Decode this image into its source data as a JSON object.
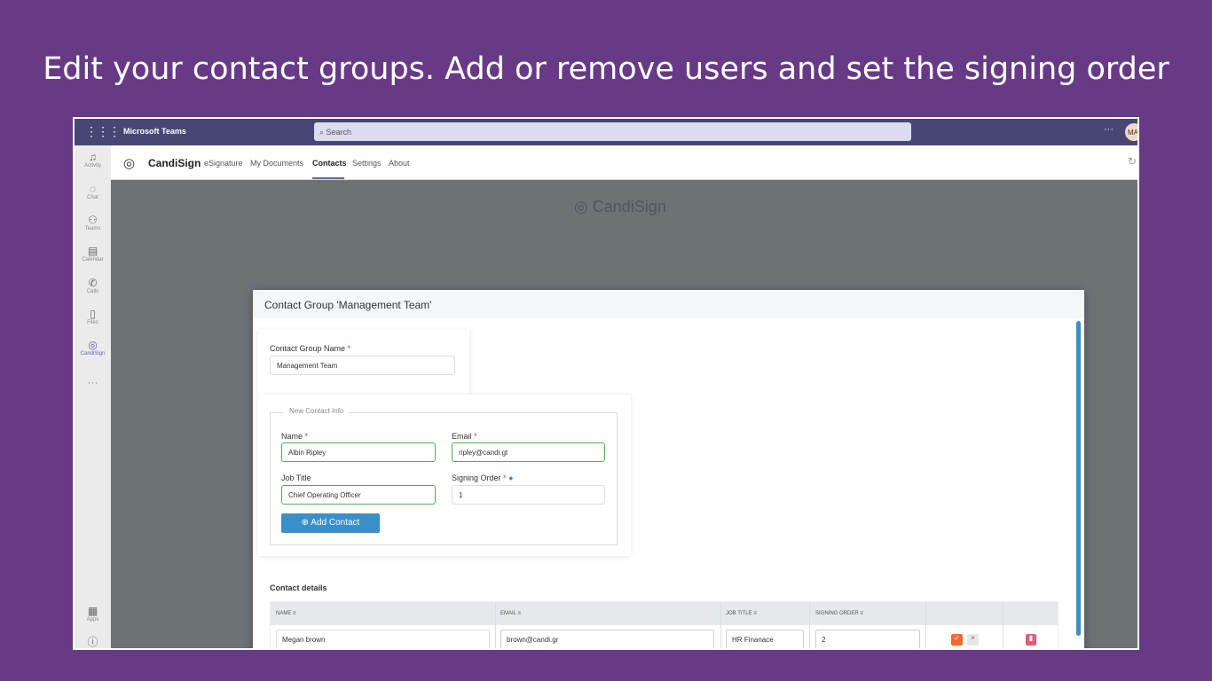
{
  "headline": "Edit your contact groups. Add or remove users and set the signing order",
  "teams": {
    "title": "Microsoft Teams",
    "search_placeholder": "Search",
    "avatar": "MA",
    "more": "···"
  },
  "sidebar": [
    {
      "label": "Activity",
      "icon": "🔔"
    },
    {
      "label": "Chat",
      "icon": "💬"
    },
    {
      "label": "Teams",
      "icon": "👥"
    },
    {
      "label": "Calendar",
      "icon": "📅"
    },
    {
      "label": "Calls",
      "icon": "📞"
    },
    {
      "label": "Files",
      "icon": "📄"
    },
    {
      "label": "CandiSign",
      "icon": "◎"
    },
    {
      "label": "Apps",
      "icon": "▦"
    }
  ],
  "app": {
    "brand": "CandiSign",
    "tabs": [
      "eSignature",
      "My Documents",
      "Contacts",
      "Settings",
      "About"
    ],
    "active_tab": "Contacts"
  },
  "modal": {
    "title": "Contact Group 'Management Team'",
    "group_name_label": "Contact Group Name",
    "group_name": "Management Team",
    "legend": "New Contact Info",
    "name_label": "Name",
    "name": "Albin Ripley",
    "email_label": "Email",
    "email": "ripley@candi.gt",
    "job_label": "Job Title",
    "job": "Chief Operating Officer",
    "order_label": "Signing Order",
    "order": "1",
    "add_button": "Add Contact",
    "details_title": "Contact details",
    "columns": [
      "NAME",
      "EMAIL",
      "JOB TITLE",
      "SIGNING ORDER"
    ],
    "rows": [
      {
        "name": "Megan brown",
        "email": "brown@candi.gr",
        "job": "HR Finanace",
        "order": "2"
      }
    ]
  },
  "colors": {
    "bg": "#673a86",
    "teams": "#464775",
    "accent": "#3a8fc8"
  }
}
